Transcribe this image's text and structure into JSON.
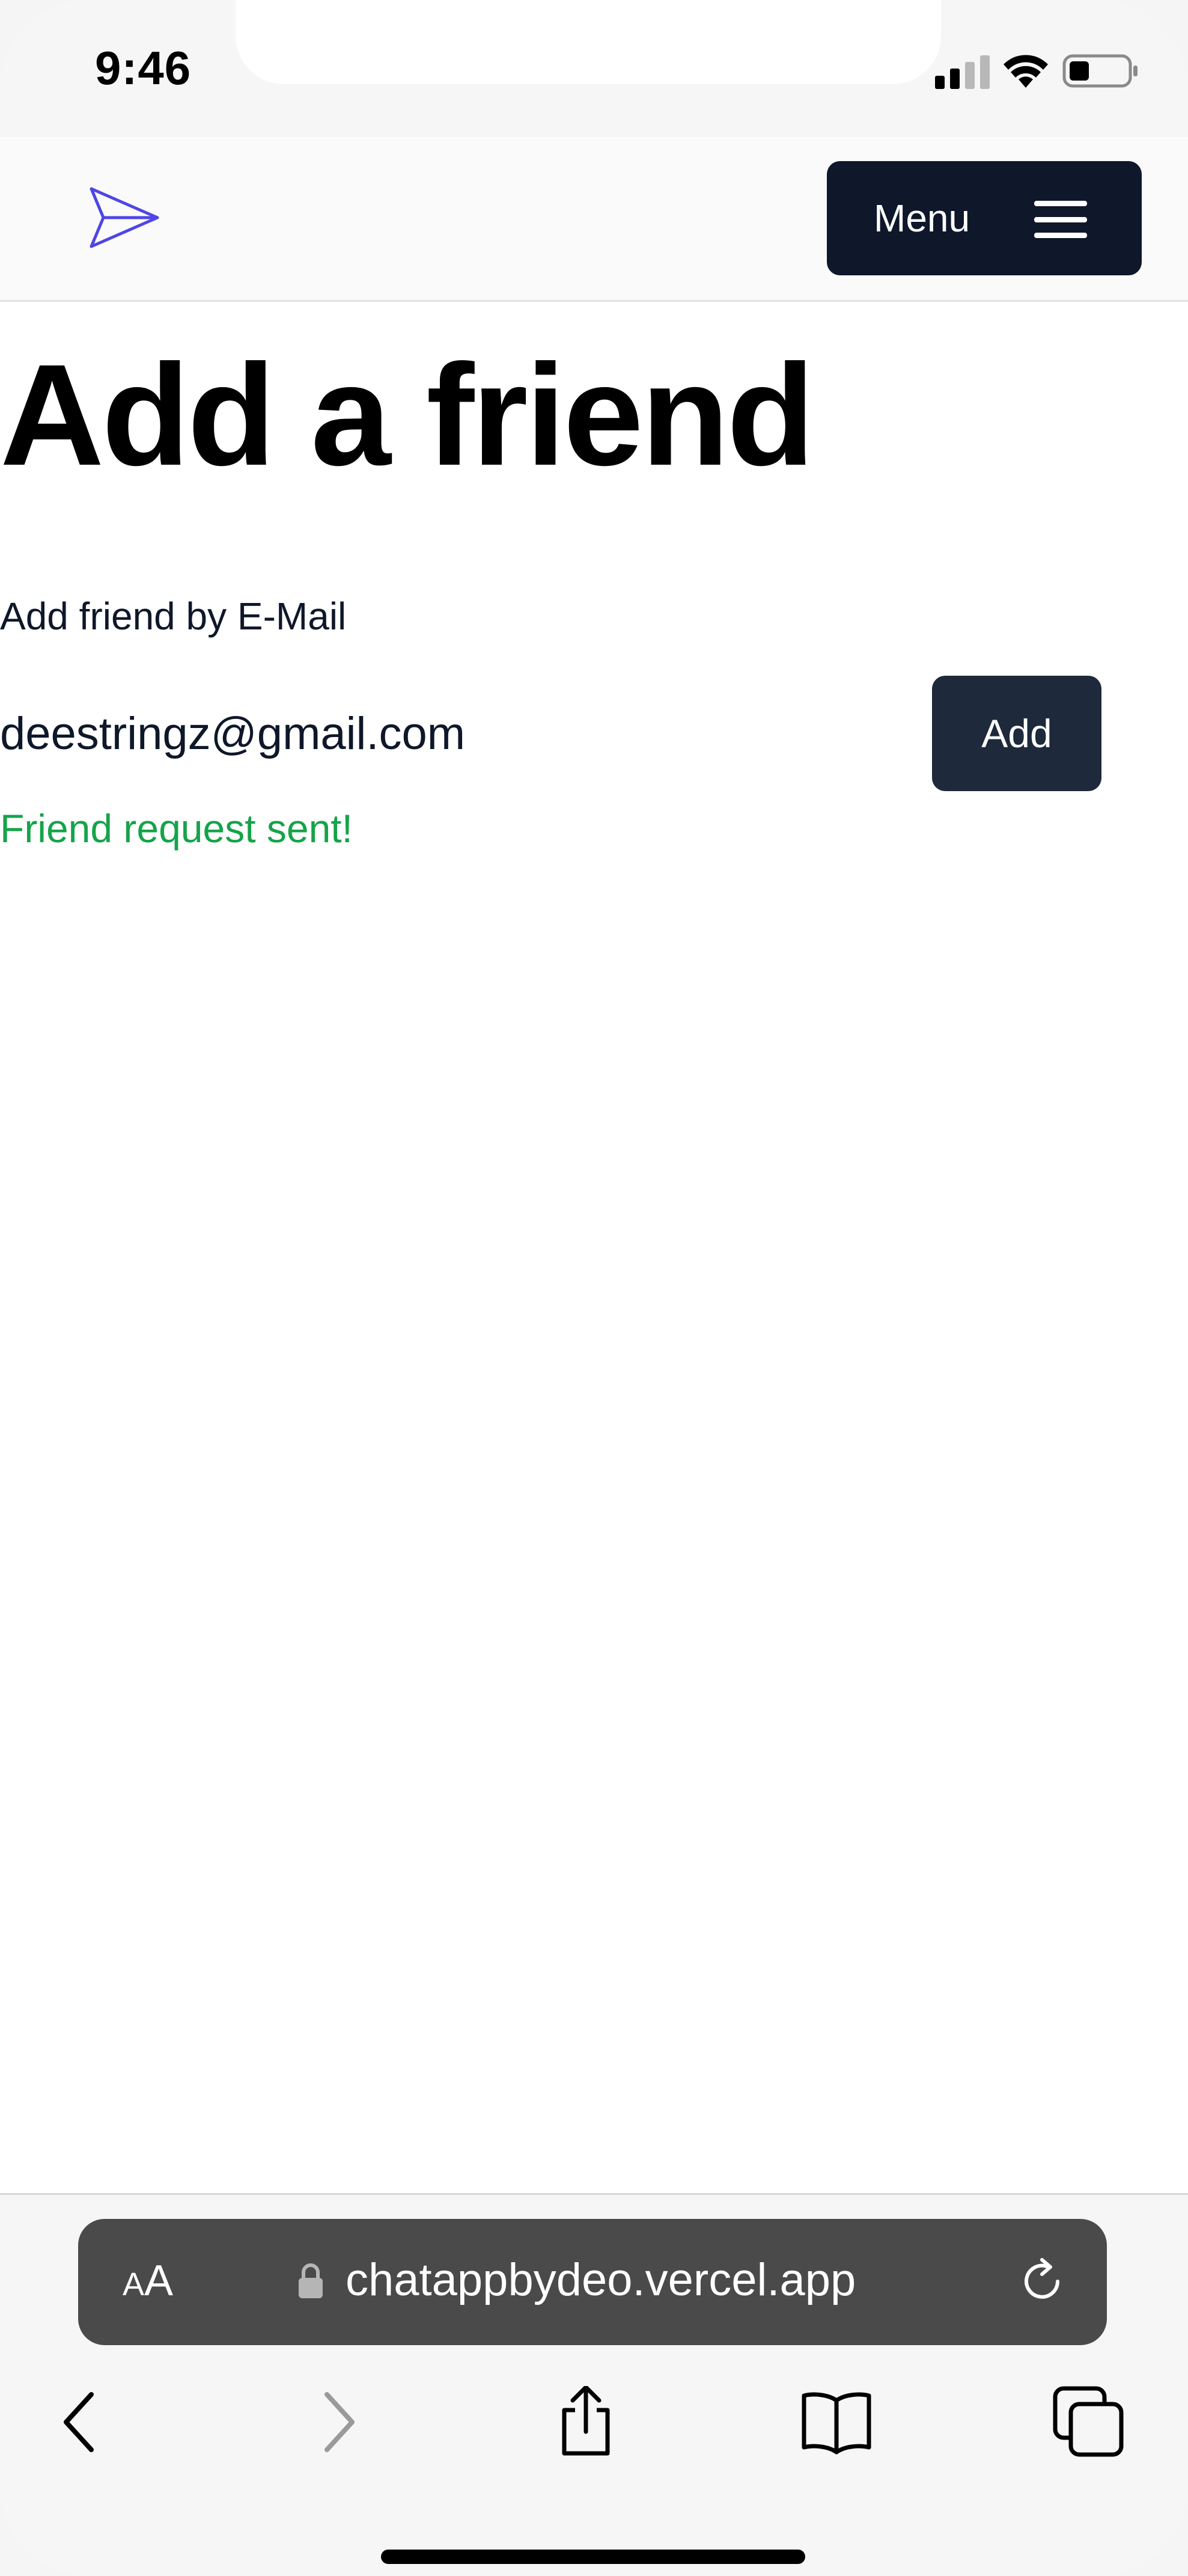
{
  "status_bar": {
    "time": "9:46",
    "icons": [
      "signal-icon",
      "wifi-icon",
      "battery-icon"
    ]
  },
  "header": {
    "logo_icon": "paper-plane-icon",
    "menu_label": "Menu",
    "menu_icon": "hamburger-icon"
  },
  "main": {
    "title": "Add a friend",
    "field_label": "Add friend by E-Mail",
    "email_value": "deestringz@gmail.com",
    "add_label": "Add",
    "status_message": "Friend request sent!"
  },
  "browser": {
    "aa_small": "A",
    "aa_large": "A",
    "url": "chatappbydeo.vercel.app",
    "nav_icons": [
      "back-icon",
      "forward-icon",
      "share-icon",
      "bookmarks-icon",
      "tabs-icon"
    ]
  },
  "colors": {
    "primary": "#0f172a",
    "add_button": "#1e293b",
    "logo": "#4f46e5",
    "success": "#16a34a",
    "address_bar": "#4a4a4a"
  }
}
